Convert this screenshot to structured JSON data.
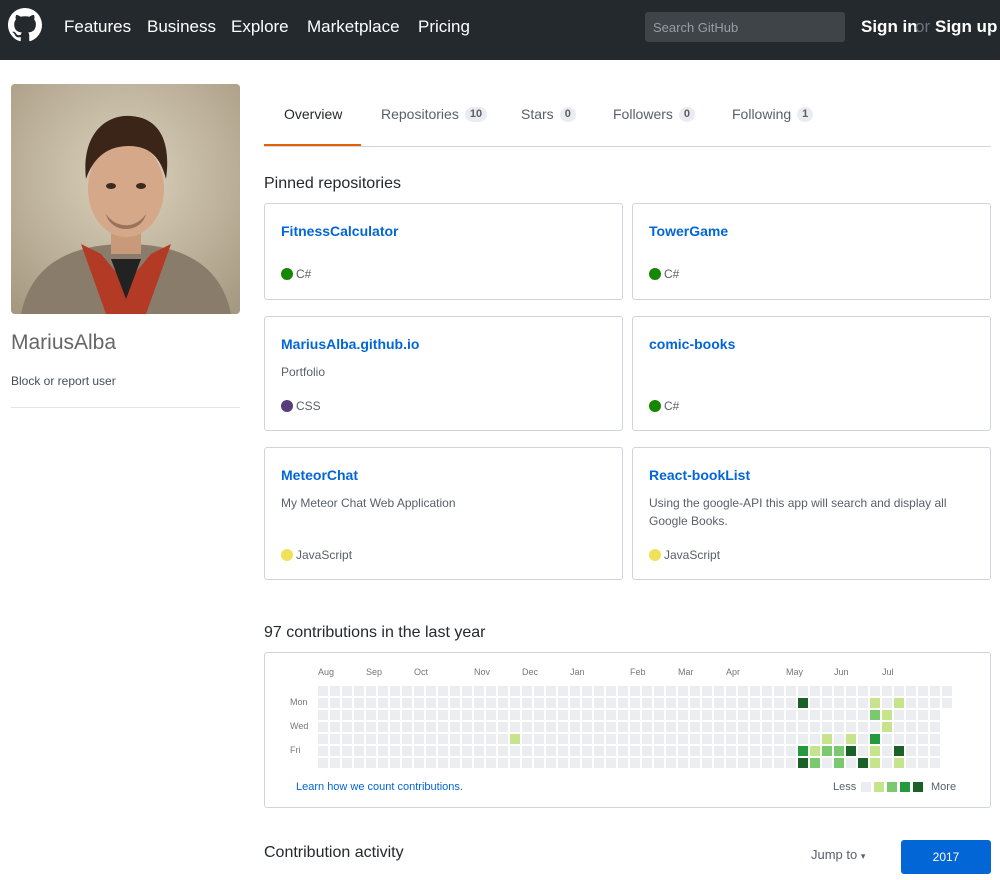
{
  "header": {
    "nav": [
      "Features",
      "Business",
      "Explore",
      "Marketplace",
      "Pricing"
    ],
    "search_placeholder": "Search GitHub",
    "sign_in": "Sign in",
    "or": "or",
    "sign_up": "Sign up",
    "logo_icon": "github-octocat-icon"
  },
  "profile": {
    "username": "MariusAlba",
    "block_label": "Block or report user"
  },
  "tabs": [
    {
      "label": "Overview",
      "count": null,
      "active": true
    },
    {
      "label": "Repositories",
      "count": "10"
    },
    {
      "label": "Stars",
      "count": "0"
    },
    {
      "label": "Followers",
      "count": "0"
    },
    {
      "label": "Following",
      "count": "1"
    }
  ],
  "pinned": {
    "heading": "Pinned repositories",
    "repos": [
      {
        "name": "FitnessCalculator",
        "desc": "",
        "lang": "C#",
        "lang_color": "#178600"
      },
      {
        "name": "TowerGame",
        "desc": "",
        "lang": "C#",
        "lang_color": "#178600"
      },
      {
        "name": "MariusAlba.github.io",
        "desc": "Portfolio",
        "lang": "CSS",
        "lang_color": "#563d7c"
      },
      {
        "name": "comic-books",
        "desc": "",
        "lang": "C#",
        "lang_color": "#178600"
      },
      {
        "name": "MeteorChat",
        "desc": "My Meteor Chat Web Application",
        "lang": "JavaScript",
        "lang_color": "#f1e05a"
      },
      {
        "name": "React-bookList",
        "desc": "Using the google-API this app will search and display all Google Books.",
        "lang": "JavaScript",
        "lang_color": "#f1e05a"
      }
    ]
  },
  "contributions": {
    "heading": "97 contributions in the last year",
    "months": [
      "Aug",
      "Sep",
      "Oct",
      "Nov",
      "Dec",
      "Jan",
      "Feb",
      "Mar",
      "Apr",
      "May",
      "Jun",
      "Jul"
    ],
    "days": [
      "Mon",
      "Wed",
      "Fri"
    ],
    "learn_link": "Learn how we count contributions.",
    "less": "Less",
    "more": "More",
    "colors": [
      "#ebedf0",
      "#c6e48b",
      "#7bc96f",
      "#239a3b",
      "#196127"
    ],
    "active_cells": [
      [
        40,
        1,
        4
      ],
      [
        40,
        5,
        3
      ],
      [
        40,
        6,
        4
      ],
      [
        16,
        4,
        1
      ],
      [
        41,
        5,
        1
      ],
      [
        41,
        6,
        2
      ],
      [
        42,
        4,
        1
      ],
      [
        42,
        5,
        2
      ],
      [
        43,
        5,
        2
      ],
      [
        43,
        6,
        2
      ],
      [
        44,
        4,
        1
      ],
      [
        44,
        5,
        4
      ],
      [
        45,
        6,
        4
      ],
      [
        46,
        1,
        1
      ],
      [
        46,
        2,
        2
      ],
      [
        46,
        4,
        3
      ],
      [
        46,
        5,
        1
      ],
      [
        46,
        6,
        1
      ],
      [
        47,
        2,
        1
      ],
      [
        47,
        3,
        1
      ],
      [
        48,
        1,
        1
      ],
      [
        48,
        5,
        4
      ],
      [
        48,
        6,
        1
      ]
    ]
  },
  "activity": {
    "heading": "Contribution activity",
    "jump_to": "Jump to",
    "year": "2017"
  }
}
